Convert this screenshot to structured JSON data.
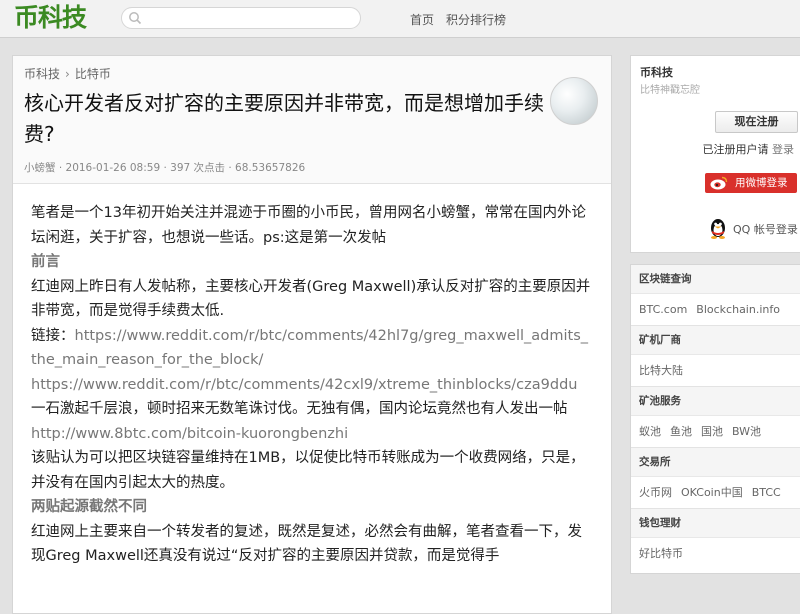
{
  "topbar": {
    "logo": "币科技",
    "search": {
      "placeholder": ""
    },
    "nav": [
      "首页",
      "积分排行榜"
    ]
  },
  "article": {
    "breadcrumb": [
      "币科技",
      "比特币"
    ],
    "title": "核心开发者反对扩容的主要原因并非带宽，而是想增加手续费?",
    "meta": "小螃蟹 · 2016-01-26 08:59 · 397 次点击 · 68.53657826",
    "paragraphs": [
      {
        "type": "text",
        "text": "笔者是一个13年初开始关注并混迹于币圈的小币民，曾用网名小螃蟹，常常在国内外论坛闲逛，关于扩容，也想说一些话。ps:这是第一次发帖"
      },
      {
        "type": "heading",
        "text": "前言"
      },
      {
        "type": "text",
        "text": "红迪网上昨日有人发帖称，主要核心开发者(Greg Maxwell)承认反对扩容的主要原因并非带宽，而是觉得手续费太低."
      },
      {
        "type": "text",
        "text": "链接："
      },
      {
        "type": "link",
        "text": "https://www.reddit.com/r/btc/comments/42hl7g/greg_maxwell_admits_the_main_reason_for_the_block/"
      },
      {
        "type": "link",
        "text": "https://www.reddit.com/r/btc/comments/42cxl9/xtreme_thinblocks/cza9ddu"
      },
      {
        "type": "text",
        "text": "一石激起千层浪，顿时招来无数笔诛讨伐。无独有偶，国内论坛竟然也有人发出一帖"
      },
      {
        "type": "link",
        "text": "http://www.8btc.com/bitcoin-kuorongbenzhi"
      },
      {
        "type": "text",
        "text": "该贴认为可以把区块链容量维持在1MB，以促使比特币转账成为一个收费网络，只是，并没有在国内引起太大的热度。"
      },
      {
        "type": "heading",
        "text": "两贴起源截然不同"
      },
      {
        "type": "text",
        "text": "红迪网上主要来自一个转发者的复述，既然是复述，必然会有曲解，笔者查看一下，发现Greg Maxwell还真没有说过“反对扩容的主要原因并贷款，而是觉得手"
      }
    ]
  },
  "sidebar": {
    "site_name": "币科技",
    "slogan": "比特神戳忘腔",
    "signup_label": "现在注册",
    "registered_text": "已注册用户请",
    "login_link": "登录",
    "weibo_label": "用微博登录",
    "qq_label": "QQ 帐号登录",
    "sections": [
      {
        "title": "区块链查询",
        "links": [
          "BTC.com",
          "Blockchain.info"
        ]
      },
      {
        "title": "矿机厂商",
        "links": [
          "比特大陆"
        ]
      },
      {
        "title": "矿池服务",
        "links": [
          "蚁池",
          "鱼池",
          "国池",
          "BW池"
        ]
      },
      {
        "title": "交易所",
        "links": [
          "火币网",
          "OKCoin中国",
          "BTCC"
        ]
      },
      {
        "title": "钱包理财",
        "links": [
          "好比特币"
        ]
      }
    ]
  },
  "colors": {
    "brand": "#3b8a22",
    "weibo": "#d9302b"
  }
}
